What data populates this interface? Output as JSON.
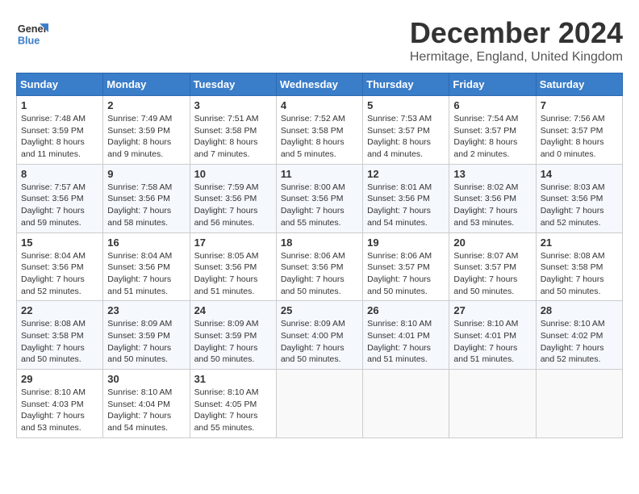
{
  "logo": {
    "line1": "General",
    "line2": "Blue"
  },
  "title": "December 2024",
  "subtitle": "Hermitage, England, United Kingdom",
  "days_of_week": [
    "Sunday",
    "Monday",
    "Tuesday",
    "Wednesday",
    "Thursday",
    "Friday",
    "Saturday"
  ],
  "weeks": [
    [
      {
        "day": "1",
        "info": "Sunrise: 7:48 AM\nSunset: 3:59 PM\nDaylight: 8 hours\nand 11 minutes."
      },
      {
        "day": "2",
        "info": "Sunrise: 7:49 AM\nSunset: 3:59 PM\nDaylight: 8 hours\nand 9 minutes."
      },
      {
        "day": "3",
        "info": "Sunrise: 7:51 AM\nSunset: 3:58 PM\nDaylight: 8 hours\nand 7 minutes."
      },
      {
        "day": "4",
        "info": "Sunrise: 7:52 AM\nSunset: 3:58 PM\nDaylight: 8 hours\nand 5 minutes."
      },
      {
        "day": "5",
        "info": "Sunrise: 7:53 AM\nSunset: 3:57 PM\nDaylight: 8 hours\nand 4 minutes."
      },
      {
        "day": "6",
        "info": "Sunrise: 7:54 AM\nSunset: 3:57 PM\nDaylight: 8 hours\nand 2 minutes."
      },
      {
        "day": "7",
        "info": "Sunrise: 7:56 AM\nSunset: 3:57 PM\nDaylight: 8 hours\nand 0 minutes."
      }
    ],
    [
      {
        "day": "8",
        "info": "Sunrise: 7:57 AM\nSunset: 3:56 PM\nDaylight: 7 hours\nand 59 minutes."
      },
      {
        "day": "9",
        "info": "Sunrise: 7:58 AM\nSunset: 3:56 PM\nDaylight: 7 hours\nand 58 minutes."
      },
      {
        "day": "10",
        "info": "Sunrise: 7:59 AM\nSunset: 3:56 PM\nDaylight: 7 hours\nand 56 minutes."
      },
      {
        "day": "11",
        "info": "Sunrise: 8:00 AM\nSunset: 3:56 PM\nDaylight: 7 hours\nand 55 minutes."
      },
      {
        "day": "12",
        "info": "Sunrise: 8:01 AM\nSunset: 3:56 PM\nDaylight: 7 hours\nand 54 minutes."
      },
      {
        "day": "13",
        "info": "Sunrise: 8:02 AM\nSunset: 3:56 PM\nDaylight: 7 hours\nand 53 minutes."
      },
      {
        "day": "14",
        "info": "Sunrise: 8:03 AM\nSunset: 3:56 PM\nDaylight: 7 hours\nand 52 minutes."
      }
    ],
    [
      {
        "day": "15",
        "info": "Sunrise: 8:04 AM\nSunset: 3:56 PM\nDaylight: 7 hours\nand 52 minutes."
      },
      {
        "day": "16",
        "info": "Sunrise: 8:04 AM\nSunset: 3:56 PM\nDaylight: 7 hours\nand 51 minutes."
      },
      {
        "day": "17",
        "info": "Sunrise: 8:05 AM\nSunset: 3:56 PM\nDaylight: 7 hours\nand 51 minutes."
      },
      {
        "day": "18",
        "info": "Sunrise: 8:06 AM\nSunset: 3:56 PM\nDaylight: 7 hours\nand 50 minutes."
      },
      {
        "day": "19",
        "info": "Sunrise: 8:06 AM\nSunset: 3:57 PM\nDaylight: 7 hours\nand 50 minutes."
      },
      {
        "day": "20",
        "info": "Sunrise: 8:07 AM\nSunset: 3:57 PM\nDaylight: 7 hours\nand 50 minutes."
      },
      {
        "day": "21",
        "info": "Sunrise: 8:08 AM\nSunset: 3:58 PM\nDaylight: 7 hours\nand 50 minutes."
      }
    ],
    [
      {
        "day": "22",
        "info": "Sunrise: 8:08 AM\nSunset: 3:58 PM\nDaylight: 7 hours\nand 50 minutes."
      },
      {
        "day": "23",
        "info": "Sunrise: 8:09 AM\nSunset: 3:59 PM\nDaylight: 7 hours\nand 50 minutes."
      },
      {
        "day": "24",
        "info": "Sunrise: 8:09 AM\nSunset: 3:59 PM\nDaylight: 7 hours\nand 50 minutes."
      },
      {
        "day": "25",
        "info": "Sunrise: 8:09 AM\nSunset: 4:00 PM\nDaylight: 7 hours\nand 50 minutes."
      },
      {
        "day": "26",
        "info": "Sunrise: 8:10 AM\nSunset: 4:01 PM\nDaylight: 7 hours\nand 51 minutes."
      },
      {
        "day": "27",
        "info": "Sunrise: 8:10 AM\nSunset: 4:01 PM\nDaylight: 7 hours\nand 51 minutes."
      },
      {
        "day": "28",
        "info": "Sunrise: 8:10 AM\nSunset: 4:02 PM\nDaylight: 7 hours\nand 52 minutes."
      }
    ],
    [
      {
        "day": "29",
        "info": "Sunrise: 8:10 AM\nSunset: 4:03 PM\nDaylight: 7 hours\nand 53 minutes."
      },
      {
        "day": "30",
        "info": "Sunrise: 8:10 AM\nSunset: 4:04 PM\nDaylight: 7 hours\nand 54 minutes."
      },
      {
        "day": "31",
        "info": "Sunrise: 8:10 AM\nSunset: 4:05 PM\nDaylight: 7 hours\nand 55 minutes."
      },
      {
        "day": "",
        "info": ""
      },
      {
        "day": "",
        "info": ""
      },
      {
        "day": "",
        "info": ""
      },
      {
        "day": "",
        "info": ""
      }
    ]
  ]
}
